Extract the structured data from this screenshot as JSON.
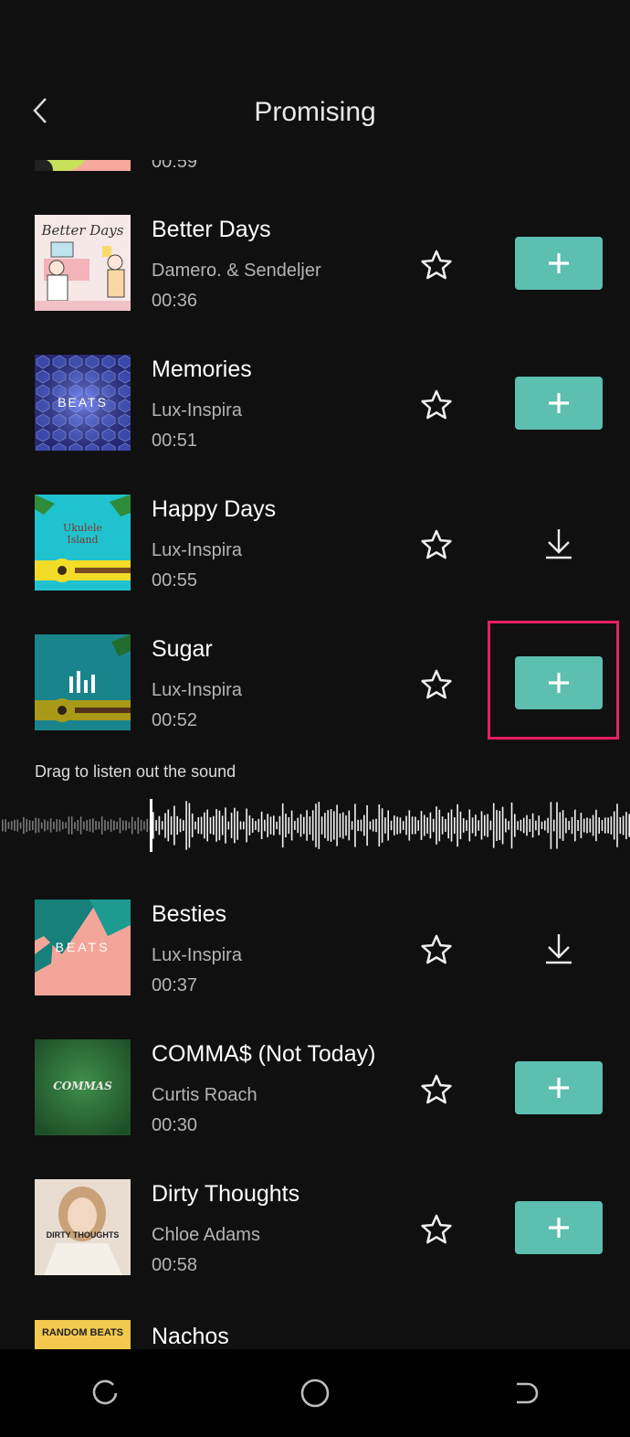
{
  "header": {
    "title": "Promising",
    "back_icon": "chevron-left-icon"
  },
  "peek_top": {
    "duration": "00:59"
  },
  "tracks": [
    {
      "name": "Better Days",
      "artist": "Damero. & Sendeljer",
      "duration": "00:36",
      "action": "add"
    },
    {
      "name": "Memories",
      "artist": "Lux-Inspira",
      "duration": "00:51",
      "action": "add"
    },
    {
      "name": "Happy Days",
      "artist": "Lux-Inspira",
      "duration": "00:55",
      "action": "download"
    },
    {
      "name": "Sugar",
      "artist": "Lux-Inspira",
      "duration": "00:52",
      "action": "add",
      "highlighted": true
    },
    {
      "name": "Besties",
      "artist": "Lux-Inspira",
      "duration": "00:37",
      "action": "download"
    },
    {
      "name": "COMMA$ (Not Today)",
      "artist": "Curtis Roach",
      "duration": "00:30",
      "action": "add"
    },
    {
      "name": "Dirty Thoughts",
      "artist": "Chloe Adams",
      "duration": "00:58",
      "action": "add"
    }
  ],
  "player": {
    "hint": "Drag to listen out the sound"
  },
  "peek_bottom": {
    "name": "Nachos"
  },
  "cover_text": {
    "better_days": "Better Days",
    "memories": "BEATS",
    "happy_days": "Ukulele Island",
    "besties": "BEATS",
    "commas": "COMMAS",
    "dirty_thoughts": "DIRTY THOUGHTS",
    "nachos": "RANDOM BEATS"
  },
  "colors": {
    "accent": "#5cbfb0",
    "highlight": "#e91e63",
    "background": "#101010"
  },
  "navbar": {
    "icons": [
      "recent-apps-icon",
      "home-icon",
      "back-nav-icon"
    ]
  }
}
